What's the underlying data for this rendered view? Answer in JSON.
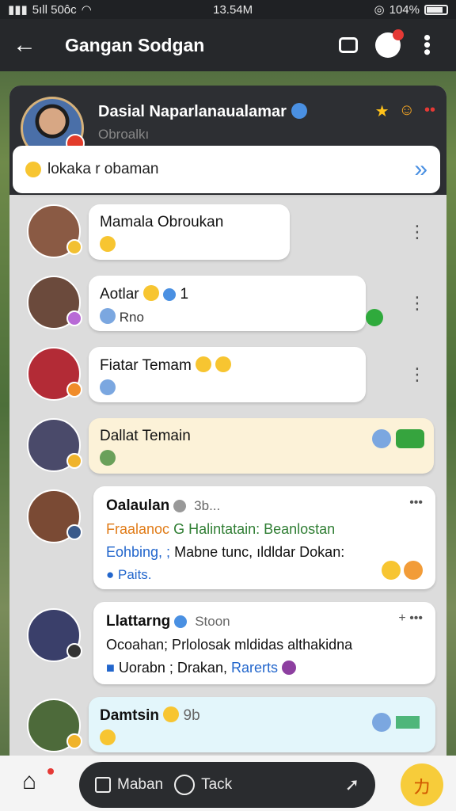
{
  "status_bar": {
    "left": "5ıll 50ôc",
    "time": "13.54M",
    "battery": "104%"
  },
  "app_bar": {
    "title": "Gangan Sodgan",
    "back_glyph": "←"
  },
  "profile_header": {
    "name": "Dasial Naparlanaualamar",
    "subtitle": "Obroalkı",
    "input_text": "lokaka r obaman",
    "send_glyph": "»"
  },
  "chats": [
    {
      "name": "Mamala Obroukan",
      "preview": "",
      "badge_color": "#f2c032"
    },
    {
      "name": "Aotlar",
      "count": "1",
      "preview": "Rno",
      "badge_color": "#b86ad6"
    },
    {
      "name": "Fiatar Temam",
      "preview": "",
      "badge_color": "#f08c2a"
    },
    {
      "name": "Dallat Temain",
      "preview": "",
      "badge_color": "#f0b32a",
      "highlight": "#fcf2d8"
    }
  ],
  "cards": [
    {
      "name": "Oalaulan",
      "time": "3b...",
      "line1_a": "Fraalanoc",
      "line1_b": "G Halintatain: Beanlostan",
      "line2_a": "Eohbing, ;",
      "line2_b": "Mabne tunc, ıldldar Dokan:",
      "line3": "Paits."
    },
    {
      "name": "Llattarng",
      "time": "Stoon",
      "line1": "Ocoahan; Prlolosak mldidas althakidna",
      "line2_a": "Uorabn ; Drakan,",
      "line2_b": "Rarerts"
    }
  ],
  "last_chat": {
    "name": "Damtsin",
    "time": "9b"
  },
  "bottom_nav": {
    "compose_label": "Maban",
    "talk_label": "Tack",
    "home_glyph": "⌂",
    "fab_glyph": "カ"
  }
}
